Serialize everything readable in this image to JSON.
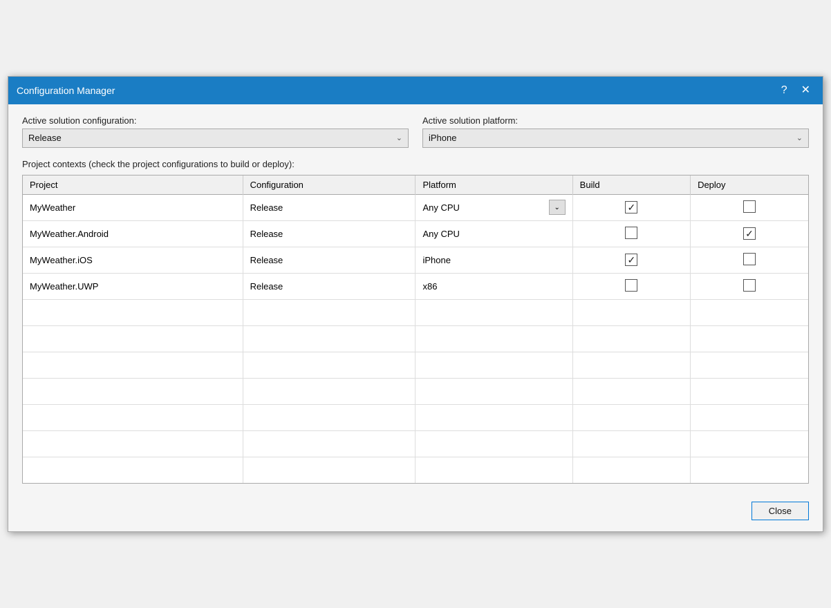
{
  "titleBar": {
    "title": "Configuration Manager",
    "helpBtn": "?",
    "closeBtn": "✕"
  },
  "activeSolution": {
    "configLabel": "Active solution configuration:",
    "configValue": "Release",
    "platformLabel": "Active solution platform:",
    "platformValue": "iPhone"
  },
  "projectContextsLabel": "Project contexts (check the project configurations to build or deploy):",
  "table": {
    "headers": [
      "Project",
      "Configuration",
      "Platform",
      "Build",
      "Deploy"
    ],
    "rows": [
      {
        "project": "MyWeather",
        "configuration": "Release",
        "platform": "Any CPU",
        "hasPlatformDropdown": true,
        "build": true,
        "deploy": false
      },
      {
        "project": "MyWeather.Android",
        "configuration": "Release",
        "platform": "Any CPU",
        "hasPlatformDropdown": false,
        "build": false,
        "deploy": true
      },
      {
        "project": "MyWeather.iOS",
        "configuration": "Release",
        "platform": "iPhone",
        "hasPlatformDropdown": false,
        "build": true,
        "deploy": false
      },
      {
        "project": "MyWeather.UWP",
        "configuration": "Release",
        "platform": "x86",
        "hasPlatformDropdown": false,
        "build": false,
        "deploy": false
      }
    ],
    "emptyRows": 7
  },
  "footer": {
    "closeLabel": "Close"
  }
}
